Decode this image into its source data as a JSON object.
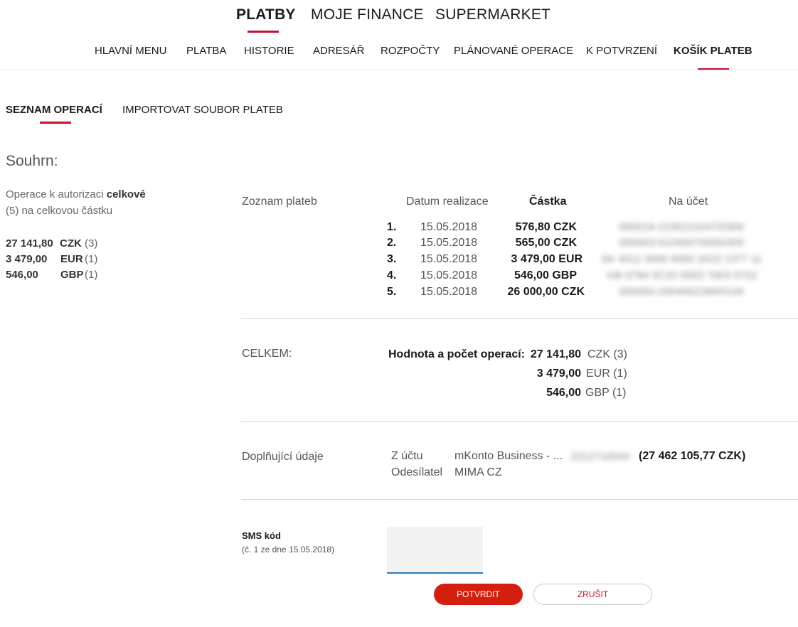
{
  "top_nav": {
    "tabs": [
      {
        "label": "PLATBY",
        "active": true
      },
      {
        "label": "MOJE FINANCE",
        "active": false
      },
      {
        "label": "SUPERMARKET",
        "active": false
      }
    ]
  },
  "sub_nav": {
    "items": [
      {
        "label": "HLAVNÍ MENU"
      },
      {
        "label": "PLATBA"
      },
      {
        "label": "HISTORIE"
      },
      {
        "label": "ADRESÁŘ"
      },
      {
        "label": "ROZPOČTY"
      },
      {
        "label": "PLÁNOVANÉ OPERACE"
      },
      {
        "label": "K POTVRZENÍ"
      },
      {
        "label": "KOŠÍK PLATEB",
        "active": true
      }
    ]
  },
  "tabs": {
    "list": "SEZNAM OPERACÍ",
    "import": "IMPORTOVAT SOUBOR PLATEB"
  },
  "summary": {
    "title": "Souhrn:",
    "line1_prefix": "Operace k autorizaci ",
    "line1_bold": "celkové",
    "line2": "(5) na celkovou částku",
    "rows": [
      {
        "amount": "27 141,80",
        "currency": "CZK",
        "count": "(3)"
      },
      {
        "amount": "3 479,00",
        "currency": "EUR",
        "count": "(1)"
      },
      {
        "amount": "546,00",
        "currency": "GBP",
        "count": "(1)"
      }
    ]
  },
  "payments": {
    "section_label": "Zoznam plateb",
    "col_date": "Datum realizace",
    "col_amount": "Částka",
    "col_account": "Na účet",
    "rows": [
      {
        "no": "1.",
        "date": "15.05.2018",
        "amount": "576,80 CZK",
        "account": "000019-2235210247/0300"
      },
      {
        "no": "2.",
        "date": "15.05.2018",
        "amount": "565,00 CZK",
        "account": "000003-0104007/0050300"
      },
      {
        "no": "3.",
        "date": "15.05.2018",
        "amount": "3 479,00 EUR",
        "account": "SK 4011 0000 0000 2610 1377 11"
      },
      {
        "no": "4.",
        "date": "15.05.2018",
        "amount": "546,00 GBP",
        "account": "GB 0784 0C20 0003 7003 0722"
      },
      {
        "no": "5.",
        "date": "15.05.2018",
        "amount": "26 000,00 CZK",
        "account": "000000-2004002286/0100"
      }
    ]
  },
  "totals": {
    "label": "CELKEM:",
    "caption": "Hodnota a počet operací:",
    "rows": [
      {
        "amount": "27 141,80",
        "currency": "CZK (3)"
      },
      {
        "amount": "3 479,00",
        "currency": "EUR (1)"
      },
      {
        "amount": "546,00",
        "currency": "GBP (1)"
      }
    ]
  },
  "additional": {
    "label": "Doplňující údaje",
    "from_label": "Z účtu",
    "from_value": "mKonto Business - ...",
    "from_number": "2212716544",
    "from_balance": "(27 462 105,77 CZK)",
    "sender_label": "Odesílatel",
    "sender_value": "MIMA CZ"
  },
  "sms": {
    "title": "SMS kód",
    "subtitle": "(č. 1 ze dne 15.05.2018)",
    "value": ""
  },
  "buttons": {
    "confirm": "POTVRDIT",
    "cancel": "ZRUŠIT"
  },
  "colors": {
    "accent": "#c8102e",
    "primary_button": "#d41e0e",
    "input_underline": "#2a7ab8"
  }
}
